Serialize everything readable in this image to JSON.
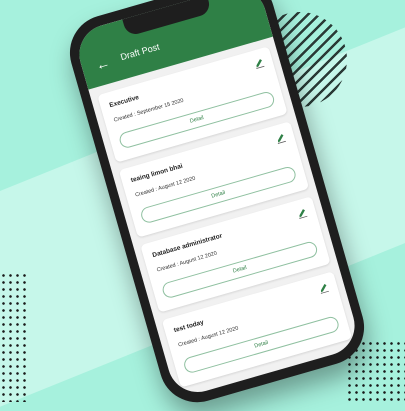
{
  "app_bar": {
    "title": "Draft Post",
    "back_icon": "arrow-left-icon"
  },
  "posts": [
    {
      "title": "Executive",
      "created": "Created : September 15 2020",
      "button": "Detail"
    },
    {
      "title": "teaing limon bhai",
      "created": "Created : August 12 2020",
      "button": "Detail"
    },
    {
      "title": "Database administrator",
      "created": "Created : August 12 2020",
      "button": "Detail"
    },
    {
      "title": "test today",
      "created": "Created : August 12 2020",
      "button": "Detail"
    }
  ],
  "colors": {
    "primary": "#2f8046",
    "background": "#a6f1dd"
  }
}
